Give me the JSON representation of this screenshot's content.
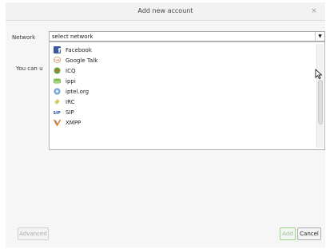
{
  "window": {
    "title": "Add new account",
    "close_glyph": "×"
  },
  "form": {
    "network_label": "Network",
    "network_selected": "select network",
    "hint_text": "You can u"
  },
  "dropdown": {
    "items": [
      {
        "label": "Facebook",
        "icon": "facebook-icon"
      },
      {
        "label": "Google Talk",
        "icon": "google-talk-icon"
      },
      {
        "label": "ICQ",
        "icon": "icq-icon"
      },
      {
        "label": "ippi",
        "icon": "ippi-icon"
      },
      {
        "label": "iptel.org",
        "icon": "iptel-icon"
      },
      {
        "label": "IRC",
        "icon": "irc-icon"
      },
      {
        "label": "SIP",
        "icon": "sip-icon"
      },
      {
        "label": "XMPP",
        "icon": "xmpp-icon"
      }
    ]
  },
  "buttons": {
    "advanced": "Advanced",
    "add": "Add",
    "cancel": "Cancel"
  },
  "colors": {
    "add_border": "#9cd08a",
    "facebook": "#3b5998",
    "icq": "#5fa641"
  }
}
